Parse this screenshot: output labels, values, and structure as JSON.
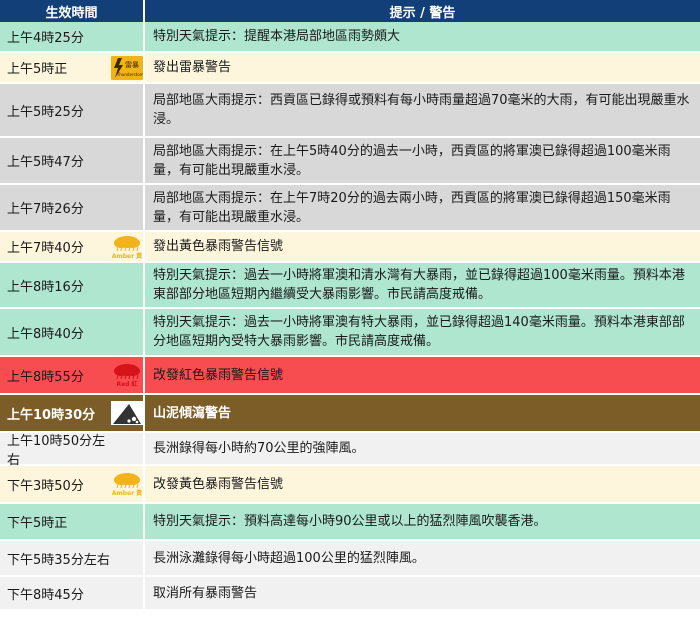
{
  "header": {
    "time": "生效時間",
    "message": "提示 / 警告"
  },
  "colors": {
    "header": "#123f78",
    "green": "#aee6cf",
    "cream": "#fdf6dc",
    "grey": "#d8d8d8",
    "red": "#f74c50",
    "brown": "#7c5d28",
    "white": "#ffffff",
    "light": "#f1f1f1"
  },
  "rows": [
    {
      "time": "上午4時25分",
      "text": "特別天氣提示：提醒本港局部地區雨勢頗大",
      "bg": "green",
      "icon": ""
    },
    {
      "time": "上午5時正",
      "text": "發出雷暴警告",
      "bg": "cream",
      "icon": "thunderstorm-icon",
      "icon_text": "雷暴",
      "icon_sub": "Thunderstorm"
    },
    {
      "time": "上午5時25分",
      "text": "局部地區大雨提示：西貢區已錄得或預料有每小時雨量超過70毫米的大雨，有可能出現嚴重水浸。",
      "bg": "grey",
      "icon": ""
    },
    {
      "time": "上午5時47分",
      "text": "局部地區大雨提示：在上午5時40分的過去一小時，西貢區的將軍澳已錄得超過100毫米雨量，有可能出現嚴重水浸。",
      "bg": "grey",
      "icon": ""
    },
    {
      "time": "上午7時26分",
      "text": "局部地區大雨提示：在上午7時20分的過去兩小時，西貢區的將軍澳已錄得超過150毫米雨量，有可能出現嚴重水浸。",
      "bg": "grey",
      "icon": ""
    },
    {
      "time": "上午7時40分",
      "text": "發出黃色暴雨警告信號",
      "bg": "cream",
      "icon": "amber-rainstorm-icon",
      "icon_text": "Amber 黃"
    },
    {
      "time": "上午8時16分",
      "text": "特別天氣提示：過去一小時將軍澳和清水灣有大暴雨，並已錄得超過100毫米雨量。預料本港東部部分地區短期內繼續受大暴雨影響。市民請高度戒備。",
      "bg": "green",
      "icon": ""
    },
    {
      "time": "上午8時40分",
      "text": "特別天氣提示：過去一小時將軍澳有特大暴雨，並已錄得超過140毫米雨量。預料本港東部部分地區短期內受特大暴雨影響。市民請高度戒備。",
      "bg": "green",
      "icon": ""
    },
    {
      "time": "上午8時55分",
      "text": "改發紅色暴雨警告信號",
      "bg": "red",
      "icon": "red-rainstorm-icon",
      "icon_text": "Red 紅"
    },
    {
      "time": "上午10時30分",
      "text": "山泥傾瀉警告",
      "bg": "brown",
      "icon": "landslip-icon",
      "bold": true,
      "fg": "white"
    },
    {
      "time": "上午10時50分左右",
      "text": "長洲錄得每小時約70公里的強陣風。",
      "bg": "light",
      "icon": ""
    },
    {
      "time": "下午3時50分",
      "text": "改發黃色暴雨警告信號",
      "bg": "cream",
      "icon": "amber-rainstorm-icon",
      "icon_text": "Amber 黃"
    },
    {
      "time": "下午5時正",
      "text": "特別天氣提示：預料高達每小時90公里或以上的猛烈陣風吹襲香港。",
      "bg": "green",
      "icon": ""
    },
    {
      "time": "下午5時35分左右",
      "text": "長洲泳灘錄得每小時超過100公里的猛烈陣風。",
      "bg": "light",
      "icon": ""
    },
    {
      "time": "下午8時45分",
      "text": "取消所有暴雨警告",
      "bg": "light",
      "icon": ""
    }
  ]
}
